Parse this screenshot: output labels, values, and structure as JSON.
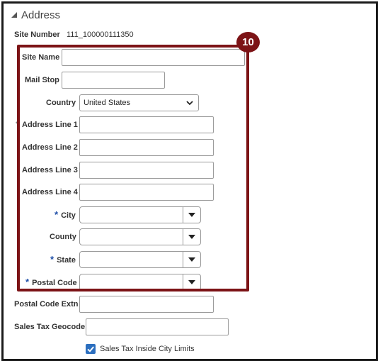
{
  "section": {
    "title": "Address"
  },
  "site_number": {
    "label": "Site Number",
    "value": "111_100000111350"
  },
  "fields": {
    "site_name": {
      "label": "Site Name",
      "value": ""
    },
    "mail_stop": {
      "label": "Mail Stop",
      "value": ""
    },
    "country": {
      "label": "Country",
      "value": "United States"
    },
    "address_line_1": {
      "label": "Address Line 1",
      "value": ""
    },
    "address_line_2": {
      "label": "Address Line 2",
      "value": ""
    },
    "address_line_3": {
      "label": "Address Line 3",
      "value": ""
    },
    "address_line_4": {
      "label": "Address Line 4",
      "value": ""
    },
    "city": {
      "label": "City",
      "required_mark": "*",
      "value": ""
    },
    "county": {
      "label": "County",
      "value": ""
    },
    "state": {
      "label": "State",
      "required_mark": "*",
      "value": ""
    },
    "postal_code": {
      "label": "Postal Code",
      "required_mark": "*",
      "value": ""
    },
    "postal_code_extn": {
      "label": "Postal Code Extn",
      "value": ""
    },
    "sales_tax_geocode": {
      "label": "Sales Tax Geocode",
      "value": ""
    }
  },
  "sales_tax_inside_city_limits": {
    "label": "Sales Tax Inside City Limits",
    "checked": true
  },
  "callout": {
    "number": "10",
    "color": "#7c1316"
  },
  "colors": {
    "required": "#1f4fa8",
    "checkbox": "#2c6fbf"
  }
}
